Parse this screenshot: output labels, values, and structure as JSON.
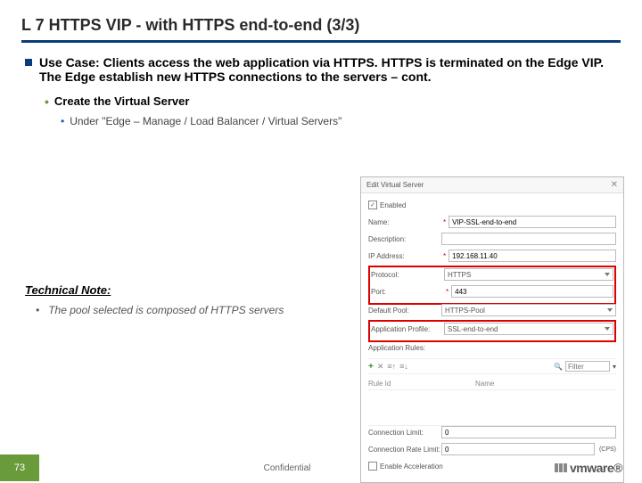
{
  "title": "L 7 HTTPS VIP - with HTTPS end-to-end (3/3)",
  "bullets": {
    "main": "Use Case: Clients access the web application via HTTPS. HTTPS is terminated on the Edge VIP. The Edge establish new HTTPS connections to the servers – cont.",
    "sub1": "Create the Virtual Server",
    "sub2": "Under \"Edge – Manage /  Load Balancer / Virtual Servers\""
  },
  "form": {
    "header": "Edit Virtual Server",
    "enabled_label": "Enabled",
    "rows": {
      "name": {
        "label": "Name:",
        "value": "VIP-SSL-end-to-end"
      },
      "description": {
        "label": "Description:",
        "value": ""
      },
      "ip": {
        "label": "IP Address:",
        "value": "192.168.11.40"
      },
      "protocol": {
        "label": "Protocol:",
        "value": "HTTPS"
      },
      "port": {
        "label": "Port:",
        "value": "443"
      },
      "defaultpool": {
        "label": "Default Pool:",
        "value": "HTTPS-Pool"
      },
      "appprofile": {
        "label": "Application Profile:",
        "value": "SSL-end-to-end"
      },
      "apprules": {
        "label": "Application Rules:"
      },
      "connlimit": {
        "label": "Connection Limit:",
        "value": "0"
      },
      "connrate": {
        "label": "Connection Rate Limit:",
        "value": "0",
        "suffix": "(CPS)"
      },
      "accel": {
        "label": "Enable Acceleration"
      }
    },
    "toolbar": {
      "filter_placeholder": "Filter"
    },
    "thead": {
      "col1": "Rule Id",
      "col2": "Name"
    }
  },
  "technote": {
    "heading": "Technical Note:",
    "body": "The pool selected is composed of HTTPS servers"
  },
  "footer": {
    "page": "73",
    "confidential": "Confidential",
    "logo": "vmware"
  }
}
